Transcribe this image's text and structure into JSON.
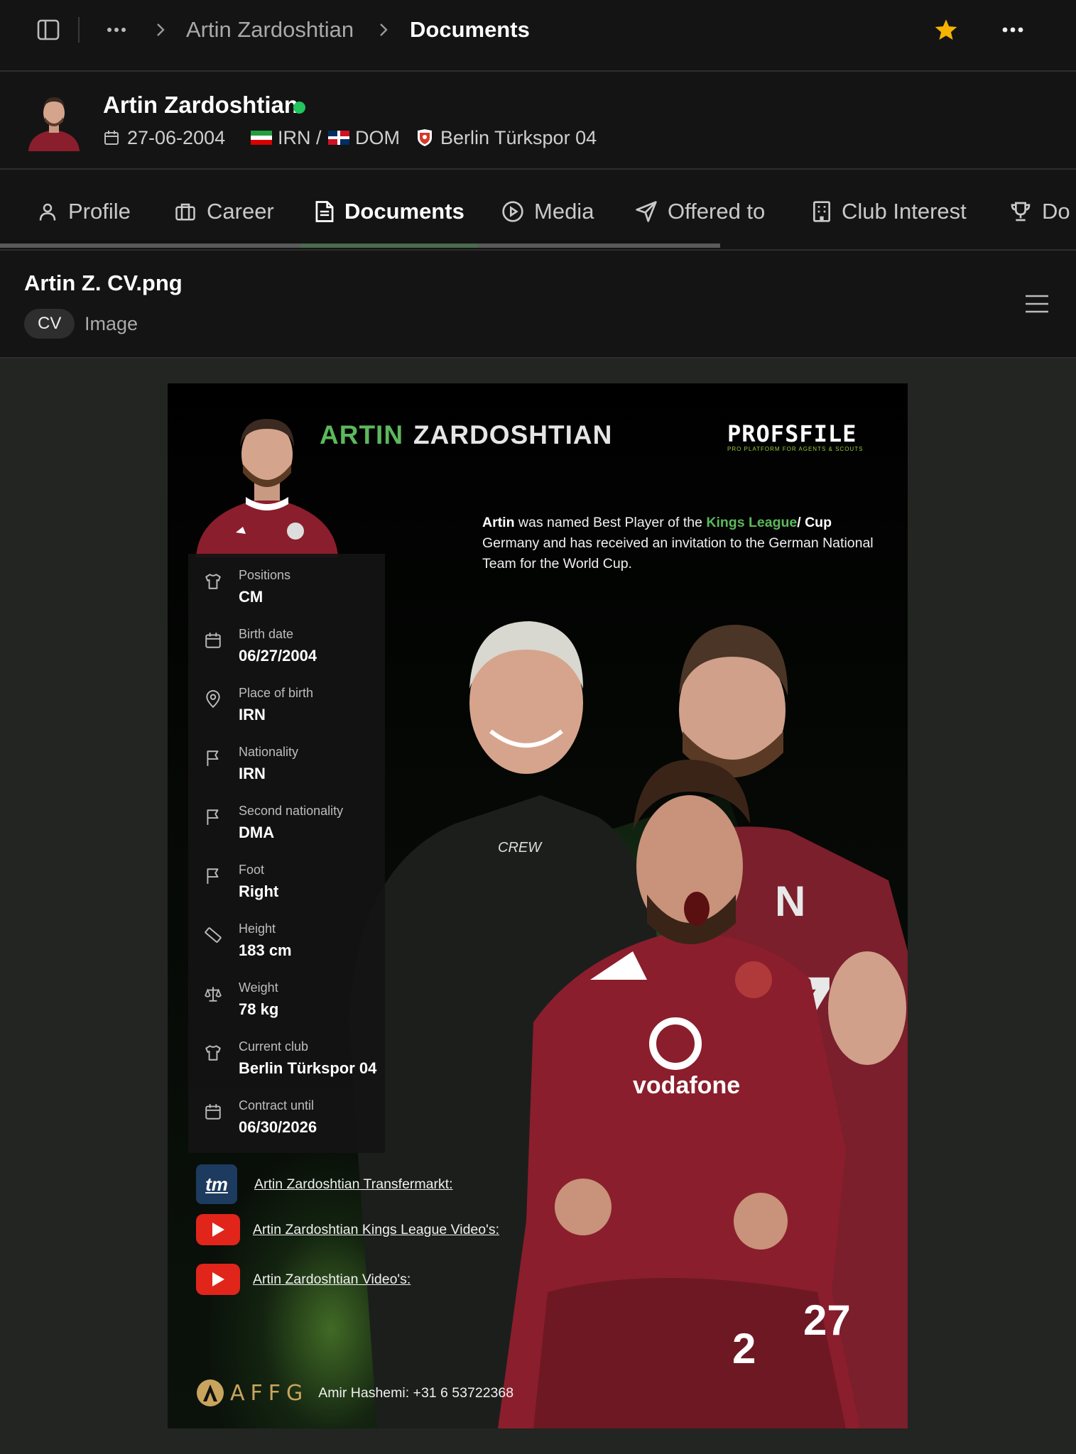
{
  "topbar": {
    "breadcrumb": [
      "Artin Zardoshtian",
      "Documents"
    ]
  },
  "player": {
    "name": "Artin Zardoshtian",
    "birthdate": "27-06-2004",
    "nationality": "IRN / ",
    "nationality2": "DOM",
    "club": "Berlin Türkspor 04"
  },
  "tabs": [
    {
      "label": "Profile",
      "icon": "user-icon"
    },
    {
      "label": "Career",
      "icon": "briefcase-icon"
    },
    {
      "label": "Documents",
      "icon": "document-icon",
      "active": true
    },
    {
      "label": "Media",
      "icon": "play-icon"
    },
    {
      "label": "Offered to",
      "icon": "send-icon"
    },
    {
      "label": "Club Interest",
      "icon": "building-icon"
    },
    {
      "label": "Do",
      "icon": "trophy-icon"
    }
  ],
  "document": {
    "filename": "Artin Z. CV.png",
    "tag": "CV",
    "type": "Image"
  },
  "cv": {
    "first_name": "ARTIN",
    "last_name": "ZARDOSHTIAN",
    "logo_main": "PROFSFILE",
    "logo_sub": "PRO PLATFORM FOR AGENTS & SCOUTS",
    "bio": {
      "p1": "Artin",
      "p2": " was named Best Player of the ",
      "p3": "Kings League",
      "p4": "/ Cup",
      "p5": " Germany and has received an invitation to the German National Team for the World Cup."
    },
    "fields": [
      {
        "label": "Positions",
        "value": "CM"
      },
      {
        "label": "Birth date",
        "value": "06/27/2004"
      },
      {
        "label": "Place of birth",
        "value": "IRN"
      },
      {
        "label": "Nationality",
        "value": "IRN"
      },
      {
        "label": "Second nationality",
        "value": "DMA"
      },
      {
        "label": "Foot",
        "value": "Right"
      },
      {
        "label": "Height",
        "value": "183 cm"
      },
      {
        "label": "Weight",
        "value": "78 kg"
      },
      {
        "label": "Current club",
        "value": "Berlin Türkspor 04"
      },
      {
        "label": "Contract until",
        "value": "06/30/2026"
      }
    ],
    "links": [
      {
        "label": "Artin Zardoshtian Transfermarkt:",
        "badge": "tm"
      },
      {
        "label": "Artin Zardoshtian Kings League Video's:"
      },
      {
        "label": "Artin Zardoshtian Video's:"
      }
    ],
    "footer_brand": "AFFG",
    "footer_contact": "Amir Hashemi: +31 6 53722368",
    "jersey_text": "vodafone",
    "hoodie_text": "CREW"
  },
  "colors": {
    "accent_green": "#5cb85c",
    "star": "#f5b301",
    "online": "#22c55e",
    "jersey": "#7a1f2b"
  }
}
